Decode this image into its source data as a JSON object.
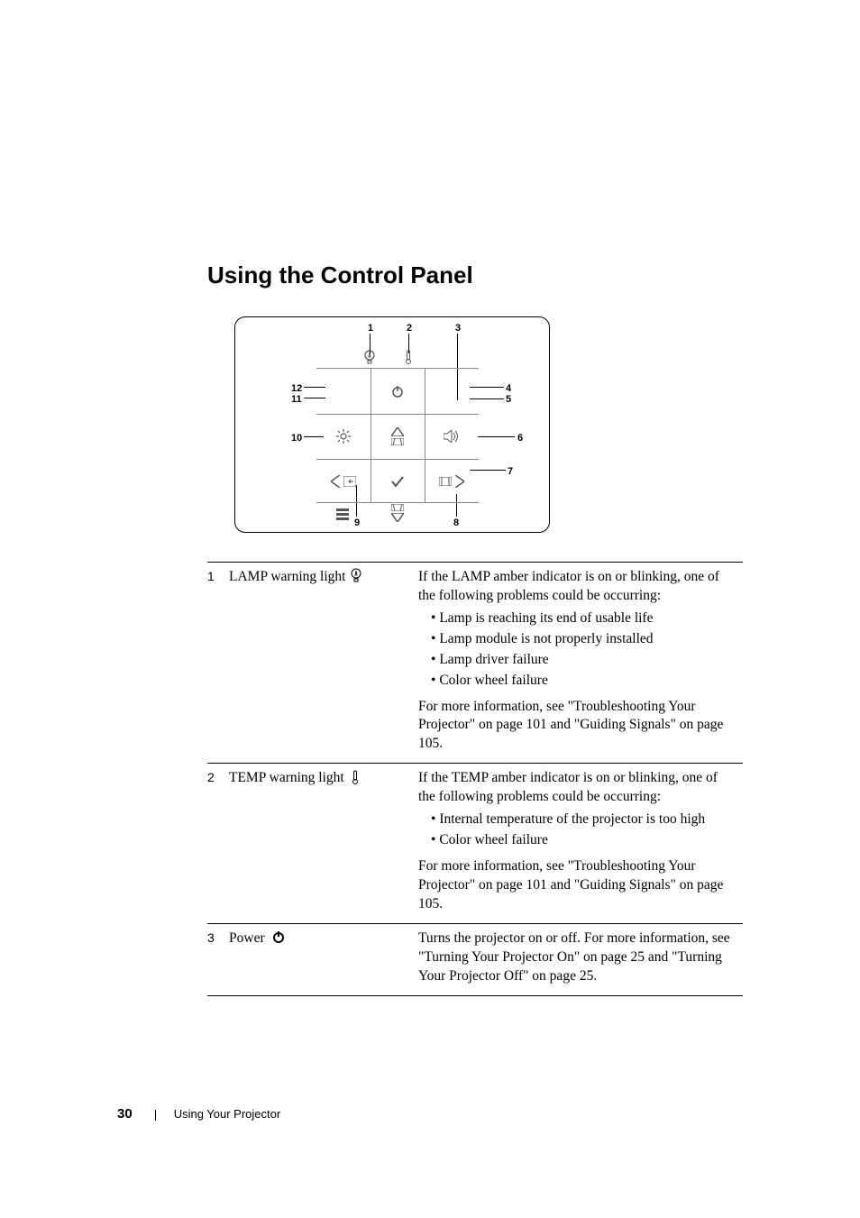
{
  "heading": "Using the Control Panel",
  "diagram": {
    "numbers": {
      "n1": "1",
      "n2": "2",
      "n3": "3",
      "n4": "4",
      "n5": "5",
      "n6": "6",
      "n7": "7",
      "n8": "8",
      "n9": "9",
      "n10": "10",
      "n11": "11",
      "n12": "12"
    }
  },
  "rows": [
    {
      "num": "1",
      "label": "LAMP warning light",
      "icon": "lamp-icon",
      "intro": "If the LAMP amber indicator is on or blinking, one of the following problems could be occurring:",
      "bullets": [
        "Lamp is reaching its end of usable life",
        "Lamp module is not properly installed",
        "Lamp driver failure",
        "Color wheel failure"
      ],
      "outro": "For more information, see \"Troubleshooting Your Projector\" on page 101 and \"Guiding Signals\" on page 105."
    },
    {
      "num": "2",
      "label": "TEMP warning light",
      "icon": "temp-icon",
      "intro": "If the TEMP amber indicator is on or blinking, one of the following problems could be occurring:",
      "bullets": [
        "Internal temperature of the projector is too high",
        "Color wheel failure"
      ],
      "outro": "For more information, see \"Troubleshooting Your Projector\" on page 101 and \"Guiding Signals\" on page 105."
    },
    {
      "num": "3",
      "label": "Power",
      "icon": "power-icon",
      "body": "Turns the projector on or off. For more information, see \"Turning Your Projector On\" on page 25 and \"Turning Your Projector Off\" on page 25."
    }
  ],
  "footer": {
    "page": "30",
    "section": "Using Your Projector"
  }
}
